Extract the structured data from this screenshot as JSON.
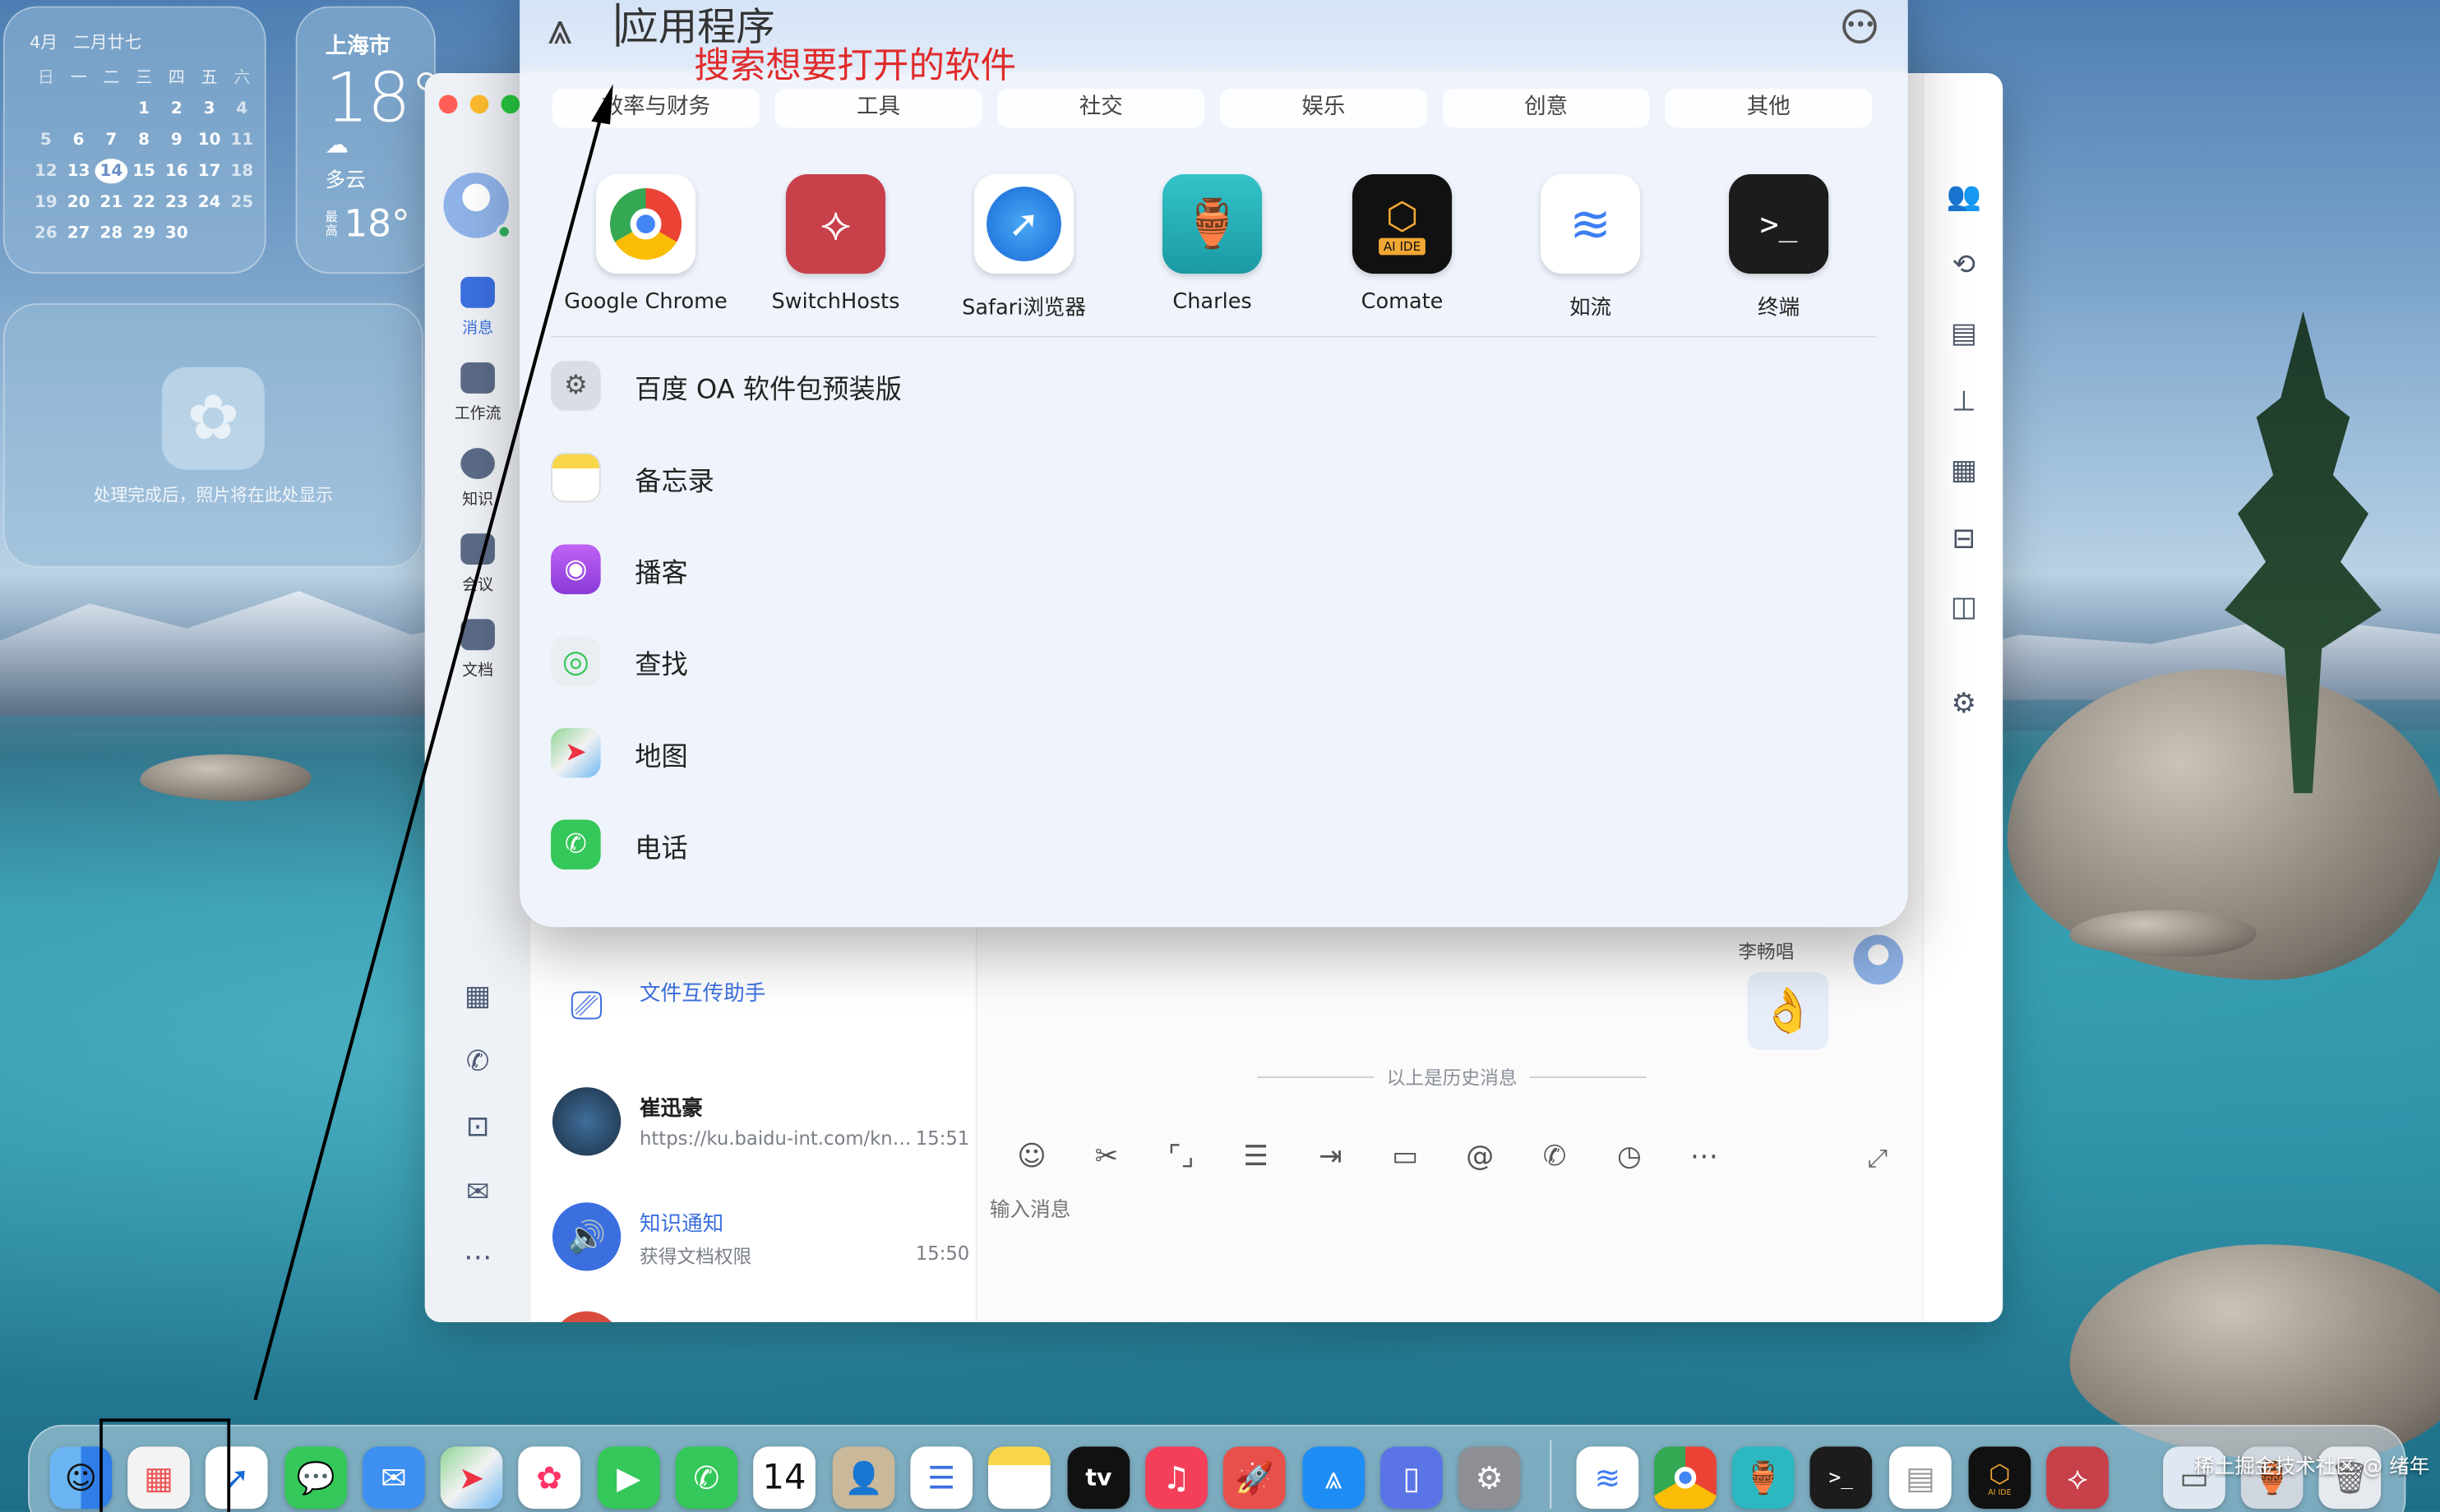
{
  "colors": {
    "accent": "#3b6fe0",
    "annotation": "#e02b2b"
  },
  "calendar": {
    "month": "4月",
    "lunar": "二月廿七",
    "weekdays": [
      "日",
      "一",
      "二",
      "三",
      "四",
      "五",
      "六"
    ],
    "weeks": [
      [
        "",
        "",
        "",
        "1",
        "2",
        "3",
        "4"
      ],
      [
        "5",
        "6",
        "7",
        "8",
        "9",
        "10",
        "11"
      ],
      [
        "12",
        "13",
        "14",
        "15",
        "16",
        "17",
        "18"
      ],
      [
        "19",
        "20",
        "21",
        "22",
        "23",
        "24",
        "25"
      ],
      [
        "26",
        "27",
        "28",
        "29",
        "30",
        "",
        ""
      ]
    ],
    "today": "14"
  },
  "weather": {
    "city": "上海市",
    "temp": "18°",
    "condition_icon": "cloud-icon",
    "condition": "多云",
    "range_prefix_top": "最",
    "range_prefix_bottom": "高",
    "range_value": "18°"
  },
  "photos_widget": {
    "caption": "处理完成后，照片将在此处显示"
  },
  "chat_app": {
    "rail": [
      {
        "label": "消息",
        "active": true
      },
      {
        "label": "工作流",
        "active": false
      },
      {
        "label": "知识",
        "active": false
      },
      {
        "label": "会议",
        "active": false
      },
      {
        "label": "文档",
        "active": false
      }
    ],
    "conversations": [
      {
        "name": "文件互传助手",
        "subtitle": "",
        "time": ""
      },
      {
        "name": "崔迅豪",
        "subtitle": "https://ku.baidu-int.com/kno...",
        "time": "15:51"
      },
      {
        "name": "知识通知",
        "subtitle": "获得文档权限",
        "time": "15:50"
      }
    ],
    "chat": {
      "sender": "李畅唱",
      "sticker": "👌",
      "history_divider": "以上是历史消息",
      "input_placeholder": "输入消息"
    }
  },
  "launcher": {
    "search_text": "应用程序",
    "categories": [
      "效率与财务",
      "工具",
      "社交",
      "娱乐",
      "创意",
      "其他"
    ],
    "top_apps": [
      {
        "name": "Google Chrome",
        "icon": "chrome-icon"
      },
      {
        "name": "SwitchHosts",
        "icon": "switchhosts-icon"
      },
      {
        "name": "Safari浏览器",
        "icon": "safari-icon"
      },
      {
        "name": "Charles",
        "icon": "charles-icon"
      },
      {
        "name": "Comate",
        "icon": "comate-icon",
        "badge": "AI IDE"
      },
      {
        "name": "如流",
        "icon": "ruliu-icon"
      },
      {
        "name": "终端",
        "icon": "terminal-icon"
      }
    ],
    "list_apps": [
      {
        "name": "百度 OA 软件包预装版",
        "icon": "oa-package-icon"
      },
      {
        "name": "备忘录",
        "icon": "notes-icon"
      },
      {
        "name": "播客",
        "icon": "podcasts-icon"
      },
      {
        "name": "查找",
        "icon": "findmy-icon"
      },
      {
        "name": "地图",
        "icon": "maps-icon"
      },
      {
        "name": "电话",
        "icon": "phone-icon"
      }
    ]
  },
  "annotation": {
    "text": "搜索想要打开的软件"
  },
  "dock": {
    "calendar_day": "14",
    "tv_label": "tv",
    "comate_badge": "AI IDE"
  },
  "watermark": "稀土掘金技术社区 @ 绪年"
}
